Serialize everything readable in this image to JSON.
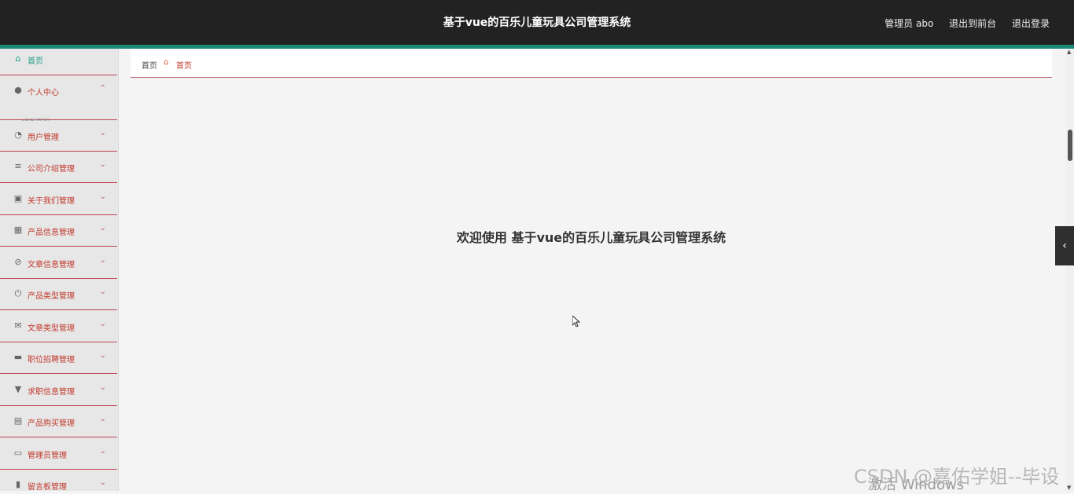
{
  "header": {
    "title": "基于vue的百乐儿童玩具公司管理系统",
    "user_label": "管理员 abo",
    "front_link": "退出到前台",
    "logout_link": "退出登录"
  },
  "sidebar": {
    "items": [
      {
        "label": "首页",
        "icon": "home-icon"
      },
      {
        "label": "个人中心",
        "icon": "user-icon",
        "expanded": true
      },
      {
        "label": "用户管理",
        "icon": "gauge-icon"
      },
      {
        "label": "公司介绍管理",
        "icon": "list-icon"
      },
      {
        "label": "关于我们管理",
        "icon": "chart-icon"
      },
      {
        "label": "产品信息管理",
        "icon": "grid-icon"
      },
      {
        "label": "文章信息管理",
        "icon": "slash-icon"
      },
      {
        "label": "产品类型管理",
        "icon": "power-icon"
      },
      {
        "label": "文章类型管理",
        "icon": "mail-icon"
      },
      {
        "label": "职位招聘管理",
        "icon": "monitor-icon"
      },
      {
        "label": "求职信息管理",
        "icon": "pin-icon"
      },
      {
        "label": "产品购买管理",
        "icon": "clipboard-icon"
      },
      {
        "label": "管理员管理",
        "icon": "chat-icon"
      },
      {
        "label": "留言板管理",
        "icon": "book-icon"
      }
    ],
    "sub_peek": "修改密码"
  },
  "breadcrumb": {
    "root": "首页",
    "current": "首页"
  },
  "main": {
    "welcome": "欢迎使用 基于vue的百乐儿童玩具公司管理系统"
  },
  "overlay": {
    "watermark": "CSDN @嘉佑学姐--毕设",
    "activate": "激活 Windows"
  },
  "colors": {
    "header_bg": "#222222",
    "accent": "#1a8a78",
    "menu_text": "#c0392b",
    "divider": "#c04050"
  }
}
